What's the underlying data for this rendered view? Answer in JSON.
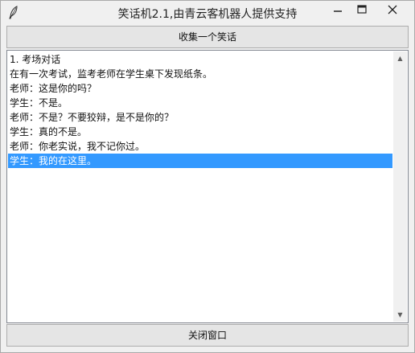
{
  "window": {
    "title": "笑话机2.1,由青云客机器人提供支持",
    "icon": "feather-icon",
    "controls": {
      "minimize": "—",
      "maximize": "☐",
      "close": "✕"
    }
  },
  "toolbar": {
    "collect_label": "收集一个笑话"
  },
  "text_area": {
    "lines": [
      "1. 考场对话",
      "在有一次考试，监考老师在学生桌下发现纸条。",
      "老师：这是你的吗？",
      "学生：不是。",
      "老师：不是？不要狡辩，是不是你的？",
      "学生：真的不是。",
      "老师：你老实说，我不记你过。",
      "学生：我的在这里。"
    ],
    "selected_line_index": 7,
    "scrollbar": {
      "up_arrow": "▲",
      "down_arrow": "▼"
    }
  },
  "footer": {
    "close_label": "关闭窗口"
  },
  "colors": {
    "selection": "#3399ff",
    "background": "#f0f0f0",
    "text_area_bg": "#ffffff"
  }
}
